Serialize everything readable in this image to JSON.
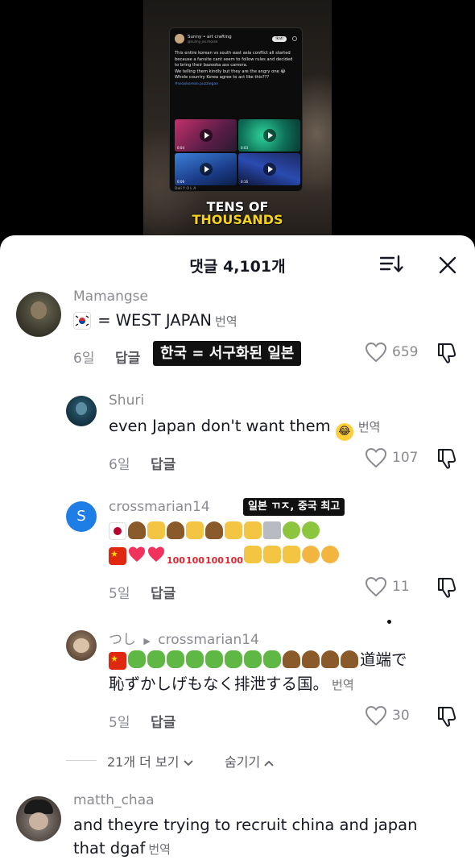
{
  "video": {
    "tweet": {
      "name": "Sunny • art crafting",
      "handle": "@sunny_on.mosse",
      "button": "Ikati",
      "text": "This entire korean vs south east asia conflict all started because a fansite cant seem to follow rules and decided to bring their bazooka ass camera.\nWe telling them kindly but they are the angry one 😭\nWhole country Korea agree to act like this???",
      "tag": "#seaxkorean.puzzlegan",
      "durations": [
        "0:04",
        "0:03",
        "0:06",
        "0:16"
      ],
      "footer": "Dali Y O L A"
    },
    "caption_line1": "TENS OF",
    "caption_line2": "THOUSANDS"
  },
  "sheet": {
    "title": "댓글 4,101개",
    "sort_icon": "sort-icon",
    "close_icon": "close-icon"
  },
  "overlays": {
    "label1": "한국 = 서구화된 일본",
    "label2": "일본 ㄲㅈ, 중국 최고"
  },
  "comments": [
    {
      "username": "Mamangse",
      "text": " = WEST JAPAN",
      "translate": "번역",
      "age": "6일",
      "reply": "답글",
      "likes": "659"
    },
    {
      "username": "Shuri",
      "text": "even Japan don't want them",
      "translate": "번역",
      "age": "6일",
      "reply": "답글",
      "likes": "107"
    },
    {
      "username": "crossmarian14",
      "age": "5일",
      "reply": "답글",
      "likes": "11"
    },
    {
      "username": "つし",
      "reply_to": "crossmarian14",
      "text_line1_end": "道端で",
      "text_line2": "恥ずかしげもなく排泄する国。",
      "translate": "번역",
      "age": "5일",
      "reply": "답글",
      "likes": "30"
    },
    {
      "username": "matth_chaa",
      "text_line1": "and theyre trying to recruit china and japan",
      "text_line2": "that dgaf",
      "translate": "번역"
    }
  ],
  "replies_more": {
    "more": "21개 더 보기",
    "hide": "숨기기"
  },
  "colors": {
    "text_primary": "#161823",
    "text_secondary": "#8a8b91",
    "label_bg": "#111111",
    "avatar_s": "#1f7ee6"
  }
}
